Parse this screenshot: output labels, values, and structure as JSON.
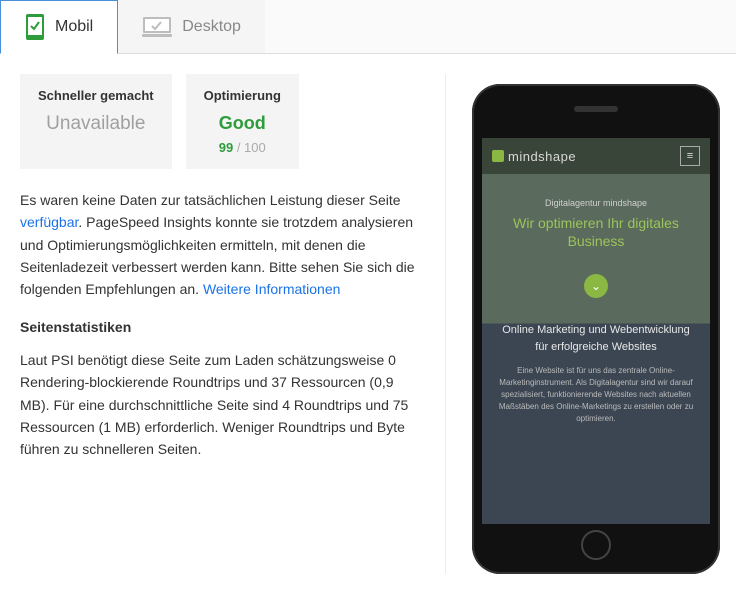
{
  "tabs": {
    "mobile": "Mobil",
    "desktop": "Desktop"
  },
  "speed_card": {
    "title": "Schneller gemacht",
    "value": "Unavailable"
  },
  "optimization_card": {
    "title": "Optimierung",
    "verdict": "Good",
    "score": "99",
    "score_max": " / 100"
  },
  "description": {
    "pre": "Es waren keine Daten zur tatsächlichen Leistung dieser Seite ",
    "link1": "verfügbar",
    "mid": ". PageSpeed Insights konnte sie trotzdem analysieren und Optimierungsmöglichkeiten ermitteln, mit denen die Seitenladezeit verbessert werden kann. Bitte sehen Sie sich die folgenden Empfehlungen an. ",
    "link2": "Weitere Informationen"
  },
  "stats_heading": "Seitenstatistiken",
  "stats_body": "Laut PSI benötigt diese Seite zum Laden schätzungsweise 0 Rendering-blockierende Roundtrips und 37 Ressourcen (0,9 MB). Für eine durchschnittliche Seite sind 4 Roundtrips und 75 Ressourcen (1 MB) erforderlich. Weniger Roundtrips und Byte führen zu schnelleren Seiten.",
  "preview": {
    "brand": "mindshape",
    "menu_glyph": "≡",
    "hero_small": "Digitalagentur mindshape",
    "hero_big": "Wir optimieren Ihr digitales Business",
    "chevron": "⌄",
    "body_title": "Online Marketing und Webentwicklung für erfolgreiche Websites",
    "body_text": "Eine Website ist für uns das zentrale Online-Marketinginstrument. Als Digitalagentur sind wir darauf spezialisiert, funktionierende Websites nach aktuellen Maßstäben des Online-Marketings zu erstellen oder zu optimieren."
  }
}
